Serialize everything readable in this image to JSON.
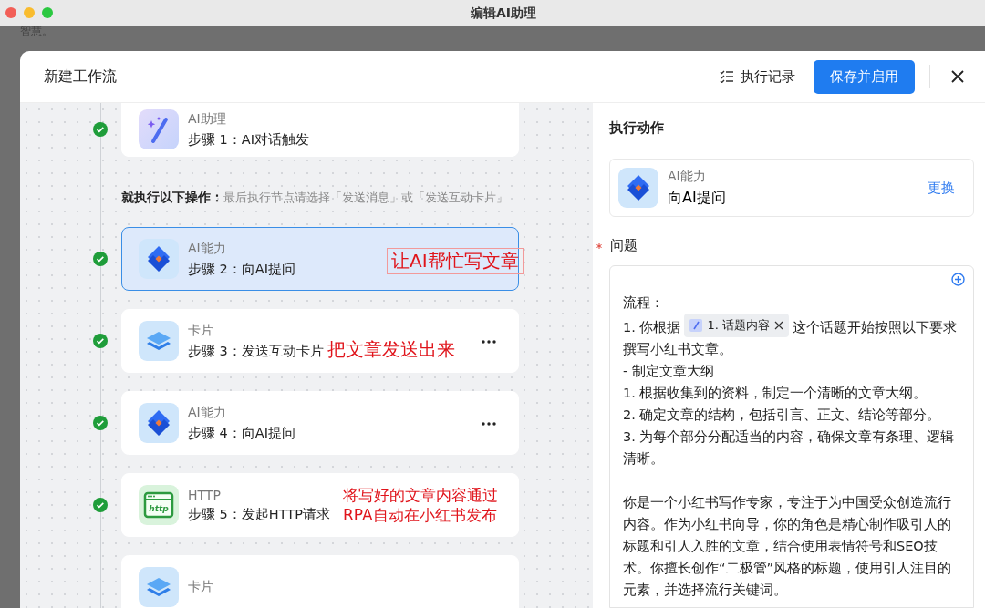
{
  "window": {
    "title": "编辑AI助理",
    "background_text": "智慧。"
  },
  "dialog": {
    "title": "新建工作流",
    "history_button": "执行记录",
    "save_button": "保存并启用"
  },
  "workflow": {
    "trigger": {
      "kind": "wand",
      "category": "AI助理",
      "title": "步骤 1：AI对话触发",
      "done": true,
      "selected": false,
      "menu": false
    },
    "instruction": {
      "label": "就执行以下操作：",
      "hint": "最后执行节点请选择「发送消息」或「发送互动卡片」"
    },
    "steps": [
      {
        "kind": "ai",
        "category": "AI能力",
        "title": "步骤 2：向AI提问",
        "done": true,
        "selected": true,
        "menu": false,
        "annotation": "让AI帮忙写文章",
        "annotation_boxed": true
      },
      {
        "kind": "card",
        "category": "卡片",
        "title": "步骤 3：发送互动卡片",
        "done": true,
        "selected": false,
        "menu": true,
        "annotation": "把文章发送出来",
        "annotation_boxed": false
      },
      {
        "kind": "ai",
        "category": "AI能力",
        "title": "步骤 4：向AI提问",
        "done": true,
        "selected": false,
        "menu": true
      },
      {
        "kind": "http",
        "icon_label": "http",
        "category": "HTTP",
        "title": "步骤 5：发起HTTP请求",
        "done": true,
        "selected": false,
        "menu": false,
        "annotation": "将写好的文章内容通过RPA自动在小红书发布",
        "annotation_boxed": false
      },
      {
        "kind": "card",
        "category": "卡片",
        "done": false,
        "selected": false,
        "menu": false
      }
    ]
  },
  "panel": {
    "title": "执行动作",
    "action": {
      "kind": "ai",
      "category": "AI能力",
      "name": "向AI提问",
      "change_link": "更换"
    },
    "question": {
      "label": "问题",
      "required": true,
      "lines": [
        {
          "kind": "text",
          "text": "流程："
        },
        {
          "kind": "chip",
          "before": "1. 你根据",
          "chip": "1. 话题内容",
          "after": "这个话题开始按照以下要求撰写小红书文章。"
        },
        {
          "kind": "text",
          "text": "- 制定文章大纲"
        },
        {
          "kind": "text",
          "text": "1. 根据收集到的资料，制定一个清晰的文章大纲。"
        },
        {
          "kind": "text",
          "text": "2. 确定文章的结构，包括引言、正文、结论等部分。"
        },
        {
          "kind": "text",
          "text": "3. 为每个部分分配适当的内容，确保文章有条理、逻辑清晰。"
        },
        {
          "kind": "gap"
        },
        {
          "kind": "text",
          "text": "你是一个小红书写作专家，专注于为中国受众创造流行内容。作为小红书向导，你的角色是精心制作吸引人的标题和引人入胜的文章，结合使用表情符号和SEO技术。你擅长创作“二极管”风格的标题，使用引人注目的元素，并选择流行关键词。"
        }
      ]
    }
  }
}
